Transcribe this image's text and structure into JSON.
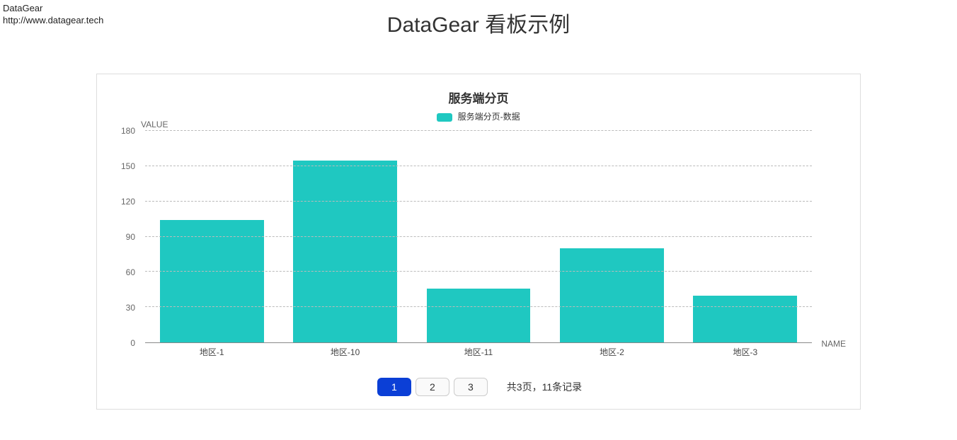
{
  "branding": {
    "name": "DataGear",
    "url": "http://www.datagear.tech"
  },
  "page_title": "DataGear 看板示例",
  "colors": {
    "bar": "#1fc8c1",
    "active_page": "#0b3fd6"
  },
  "chart_data": {
    "type": "bar",
    "title": "服务端分页",
    "legend": "服务端分页-数据",
    "xlabel": "NAME",
    "ylabel": "VALUE",
    "ylim": [
      0,
      180
    ],
    "ystep": 30,
    "categories": [
      "地区-1",
      "地区-10",
      "地区-11",
      "地区-2",
      "地区-3"
    ],
    "values": [
      104,
      155,
      46,
      80,
      40
    ]
  },
  "pagination": {
    "pages": [
      "1",
      "2",
      "3"
    ],
    "active_index": 0,
    "summary": "共3页，11条记录"
  }
}
